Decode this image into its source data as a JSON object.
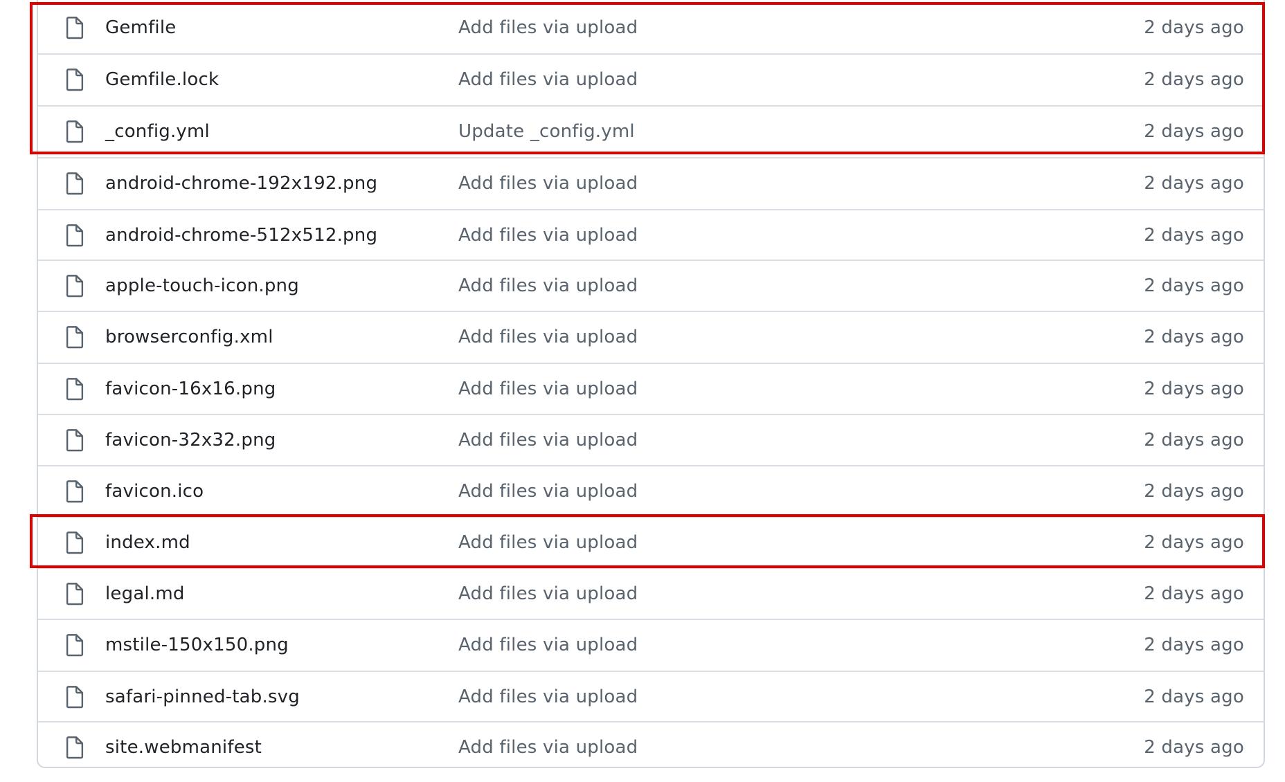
{
  "file_list": {
    "rows": [
      {
        "name": "Gemfile",
        "icon": "file-icon",
        "commit_message": "Add files via upload",
        "age": "2 days ago"
      },
      {
        "name": "Gemfile.lock",
        "icon": "file-icon",
        "commit_message": "Add files via upload",
        "age": "2 days ago"
      },
      {
        "name": "_config.yml",
        "icon": "file-icon",
        "commit_message": "Update _config.yml",
        "age": "2 days ago"
      },
      {
        "name": "android-chrome-192x192.png",
        "icon": "file-icon",
        "commit_message": "Add files via upload",
        "age": "2 days ago"
      },
      {
        "name": "android-chrome-512x512.png",
        "icon": "file-icon",
        "commit_message": "Add files via upload",
        "age": "2 days ago"
      },
      {
        "name": "apple-touch-icon.png",
        "icon": "file-icon",
        "commit_message": "Add files via upload",
        "age": "2 days ago"
      },
      {
        "name": "browserconfig.xml",
        "icon": "file-icon",
        "commit_message": "Add files via upload",
        "age": "2 days ago"
      },
      {
        "name": "favicon-16x16.png",
        "icon": "file-icon",
        "commit_message": "Add files via upload",
        "age": "2 days ago"
      },
      {
        "name": "favicon-32x32.png",
        "icon": "file-icon",
        "commit_message": "Add files via upload",
        "age": "2 days ago"
      },
      {
        "name": "favicon.ico",
        "icon": "file-icon",
        "commit_message": "Add files via upload",
        "age": "2 days ago"
      },
      {
        "name": "index.md",
        "icon": "file-icon",
        "commit_message": "Add files via upload",
        "age": "2 days ago"
      },
      {
        "name": "legal.md",
        "icon": "file-icon",
        "commit_message": "Add files via upload",
        "age": "2 days ago"
      },
      {
        "name": "mstile-150x150.png",
        "icon": "file-icon",
        "commit_message": "Add files via upload",
        "age": "2 days ago"
      },
      {
        "name": "safari-pinned-tab.svg",
        "icon": "file-icon",
        "commit_message": "Add files via upload",
        "age": "2 days ago"
      },
      {
        "name": "site.webmanifest",
        "icon": "file-icon",
        "commit_message": "Add files via upload",
        "age": "2 days ago"
      }
    ]
  },
  "annotations": {
    "highlight_color": "#e10000",
    "highlighted_row_groups": [
      [
        "Gemfile",
        "Gemfile.lock",
        "_config.yml"
      ],
      [
        "index.md"
      ]
    ]
  },
  "colors": {
    "border": "#d0d7de",
    "divider": "#d8dee4",
    "text_primary": "#1f2328",
    "text_secondary": "#59636e",
    "icon": "#59636e"
  }
}
